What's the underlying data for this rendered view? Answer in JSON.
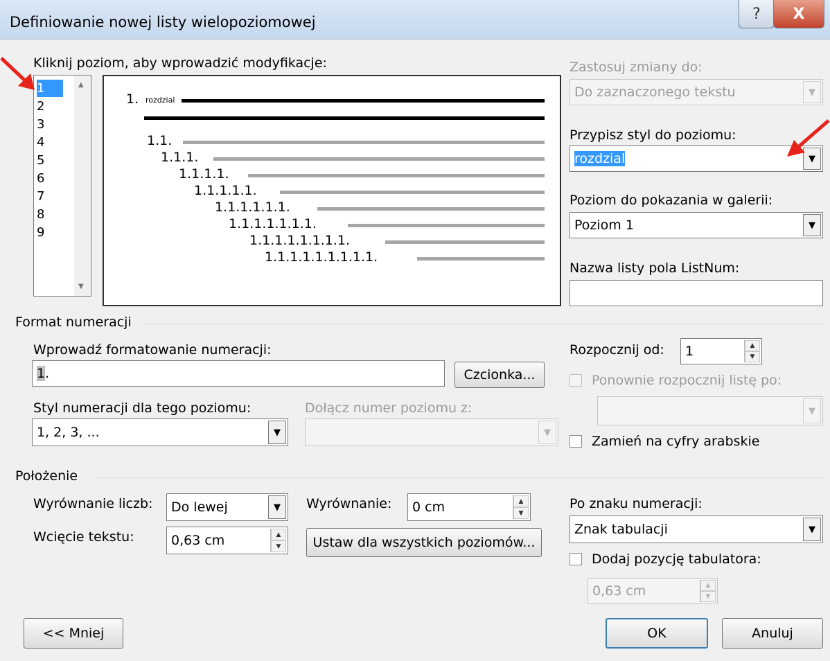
{
  "window": {
    "title": "Definiowanie nowej listy wielopoziomowej",
    "help_label": "?",
    "close_label": "X"
  },
  "levels": {
    "label": "Kliknij poziom, aby wprowadzić modyfikacje:",
    "items": [
      "1",
      "2",
      "3",
      "4",
      "5",
      "6",
      "7",
      "8",
      "9"
    ],
    "selected": "1"
  },
  "preview": {
    "rows": [
      {
        "number": "1.",
        "text": "rozdzial"
      },
      {
        "number": "1.1.",
        "text": ""
      },
      {
        "number": "1.1.1.",
        "text": ""
      },
      {
        "number": "1.1.1.1.",
        "text": ""
      },
      {
        "number": "1.1.1.1.1.",
        "text": ""
      },
      {
        "number": "1.1.1.1.1.1.",
        "text": ""
      },
      {
        "number": "1.1.1.1.1.1.1.",
        "text": ""
      },
      {
        "number": "1.1.1.1.1.1.1.1.",
        "text": ""
      },
      {
        "number": "1.1.1.1.1.1.1.1.1.",
        "text": ""
      }
    ]
  },
  "apply_to": {
    "label": "Zastosuj zmiany do:",
    "value": "Do zaznaczonego tekstu"
  },
  "style_level": {
    "label": "Przypisz styl do poziomu:",
    "value": "rozdzial"
  },
  "gallery_level": {
    "label": "Poziom do pokazania w galerii:",
    "value": "Poziom 1"
  },
  "listnum": {
    "label": "Nazwa listy pola ListNum:",
    "value": ""
  },
  "format_group": {
    "label": "Format numeracji"
  },
  "number_format": {
    "label": "Wprowadź formatowanie numeracji:",
    "value_highlight": "1",
    "value_rest": "."
  },
  "font_button": {
    "label": "Czcionka..."
  },
  "number_style": {
    "label": "Styl numeracji dla tego poziomu:",
    "value": "1, 2, 3, ..."
  },
  "include_level": {
    "label": "Dołącz numer poziomu z:",
    "value": ""
  },
  "start_at": {
    "label": "Rozpocznij od:",
    "value": "1"
  },
  "restart_list": {
    "label": "Ponownie rozpocznij listę po:",
    "value": ""
  },
  "legal_numbers": {
    "label": "Zamień na cyfry arabskie"
  },
  "position_group": {
    "label": "Położenie"
  },
  "number_alignment": {
    "label": "Wyrównanie liczb:",
    "value": "Do lewej"
  },
  "aligned_at": {
    "label": "Wyrównanie:",
    "value": "0 cm"
  },
  "text_indent": {
    "label": "Wcięcie tekstu:",
    "value": "0,63 cm"
  },
  "set_all_levels": {
    "label": "Ustaw dla wszystkich poziomów..."
  },
  "follow_number": {
    "label": "Po znaku numeracji:",
    "value": "Znak tabulacji"
  },
  "add_tab_stop": {
    "label": "Dodaj pozycję tabulatora:",
    "value": "0,63 cm"
  },
  "buttons": {
    "less": "<< Mniej",
    "ok": "OK",
    "cancel": "Anuluj"
  },
  "colors": {
    "accent": "#3399ff",
    "annotation_arrow": "#e8231b"
  }
}
